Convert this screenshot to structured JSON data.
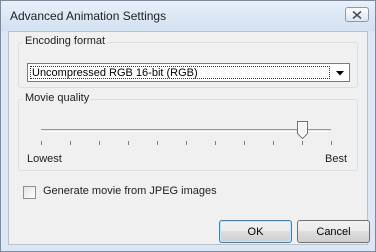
{
  "window": {
    "title": "Advanced Animation Settings",
    "close_glyph": "close-icon"
  },
  "encoding": {
    "group_label": "Encoding format",
    "selected_value": "Uncompressed RGB 16-bit (RGB)"
  },
  "quality": {
    "group_label": "Movie quality",
    "min_label": "Lowest",
    "max_label": "Best",
    "level_fraction": 0.9,
    "tick_count": 11
  },
  "jpeg_option": {
    "label": "Generate movie from JPEG images",
    "checked": false
  },
  "buttons": {
    "ok_label": "OK",
    "cancel_label": "Cancel"
  },
  "colors": {
    "titlebar": "#dce7f3",
    "client": "#f0f0f0",
    "default_button_border": "#3c7fb1"
  }
}
